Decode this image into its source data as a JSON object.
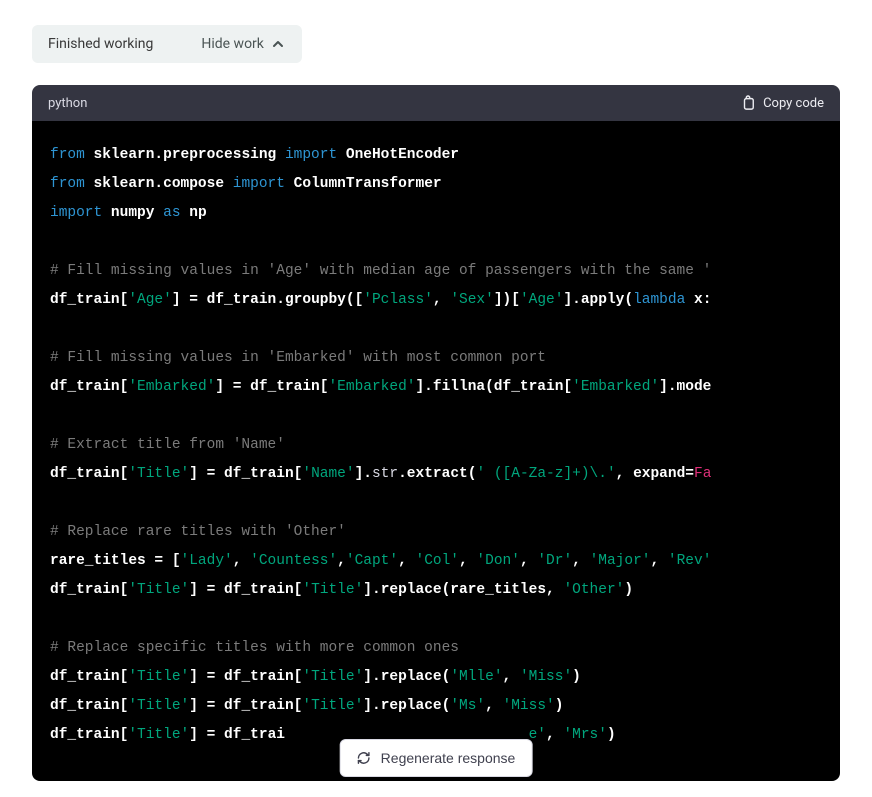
{
  "accordion": {
    "status": "Finished working",
    "toggle": "Hide work"
  },
  "code_header": {
    "language": "python",
    "copy_label": "Copy code"
  },
  "code": {
    "l1": {
      "a": "from",
      "b": "sklearn.preprocessing",
      "c": "import",
      "d": "OneHotEncoder"
    },
    "l2": {
      "a": "from",
      "b": "sklearn.compose",
      "c": "import",
      "d": "ColumnTransformer"
    },
    "l3": {
      "a": "import",
      "b": "numpy",
      "c": "as",
      "d": "np"
    },
    "c1": "# Fill missing values in 'Age' with median age of passengers with the same '",
    "l5": {
      "a": "df_train[",
      "b": "'Age'",
      "c": "] = df_train.groupby([",
      "d": "'Pclass'",
      "e": ", ",
      "f": "'Sex'",
      "g": "])[",
      "h": "'Age'",
      "i": "].apply(",
      "j": "lambda",
      "k": " x:"
    },
    "c2": "# Fill missing values in 'Embarked' with most common port",
    "l7": {
      "a": "df_train[",
      "b": "'Embarked'",
      "c": "] = df_train[",
      "d": "'Embarked'",
      "e": "].fillna(df_train[",
      "f": "'Embarked'",
      "g": "].mode"
    },
    "c3": "# Extract title from 'Name'",
    "l9": {
      "a": "df_train[",
      "b": "'Title'",
      "c": "] = df_train[",
      "d": "'Name'",
      "e": "].",
      "f": "str",
      "g": ".extract(",
      "h": "' ([A-Za-z]+)\\.'",
      "i": ", expand=",
      "j": "Fa"
    },
    "c4": "# Replace rare titles with 'Other'",
    "l11": {
      "a": "rare_titles = [",
      "b": "'Lady'",
      "c": ", ",
      "d": "'Countess'",
      "e": ",",
      "f": "'Capt'",
      "g": ", ",
      "h": "'Col'",
      "i": ", ",
      "j": "'Don'",
      "k": ", ",
      "l": "'Dr'",
      "m": ", ",
      "n": "'Major'",
      "o": ", ",
      "p": "'Rev'"
    },
    "l12": {
      "a": "df_train[",
      "b": "'Title'",
      "c": "] = df_train[",
      "d": "'Title'",
      "e": "].replace(rare_titles, ",
      "f": "'Other'",
      "g": ")"
    },
    "c5": "# Replace specific titles with more common ones",
    "l14": {
      "a": "df_train[",
      "b": "'Title'",
      "c": "] = df_train[",
      "d": "'Title'",
      "e": "].replace(",
      "f": "'Mlle'",
      "g": ", ",
      "h": "'Miss'",
      "i": ")"
    },
    "l15": {
      "a": "df_train[",
      "b": "'Title'",
      "c": "] = df_train[",
      "d": "'Title'",
      "e": "].replace(",
      "f": "'Ms'",
      "g": ", ",
      "h": "'Miss'",
      "i": ")"
    },
    "l16": {
      "a": "df_train[",
      "b": "'Title'",
      "c": "] = df_trai",
      "d": "e'",
      "e": ", ",
      "f": "'Mrs'",
      "g": ")"
    }
  },
  "regen": {
    "label": "Regenerate response"
  }
}
